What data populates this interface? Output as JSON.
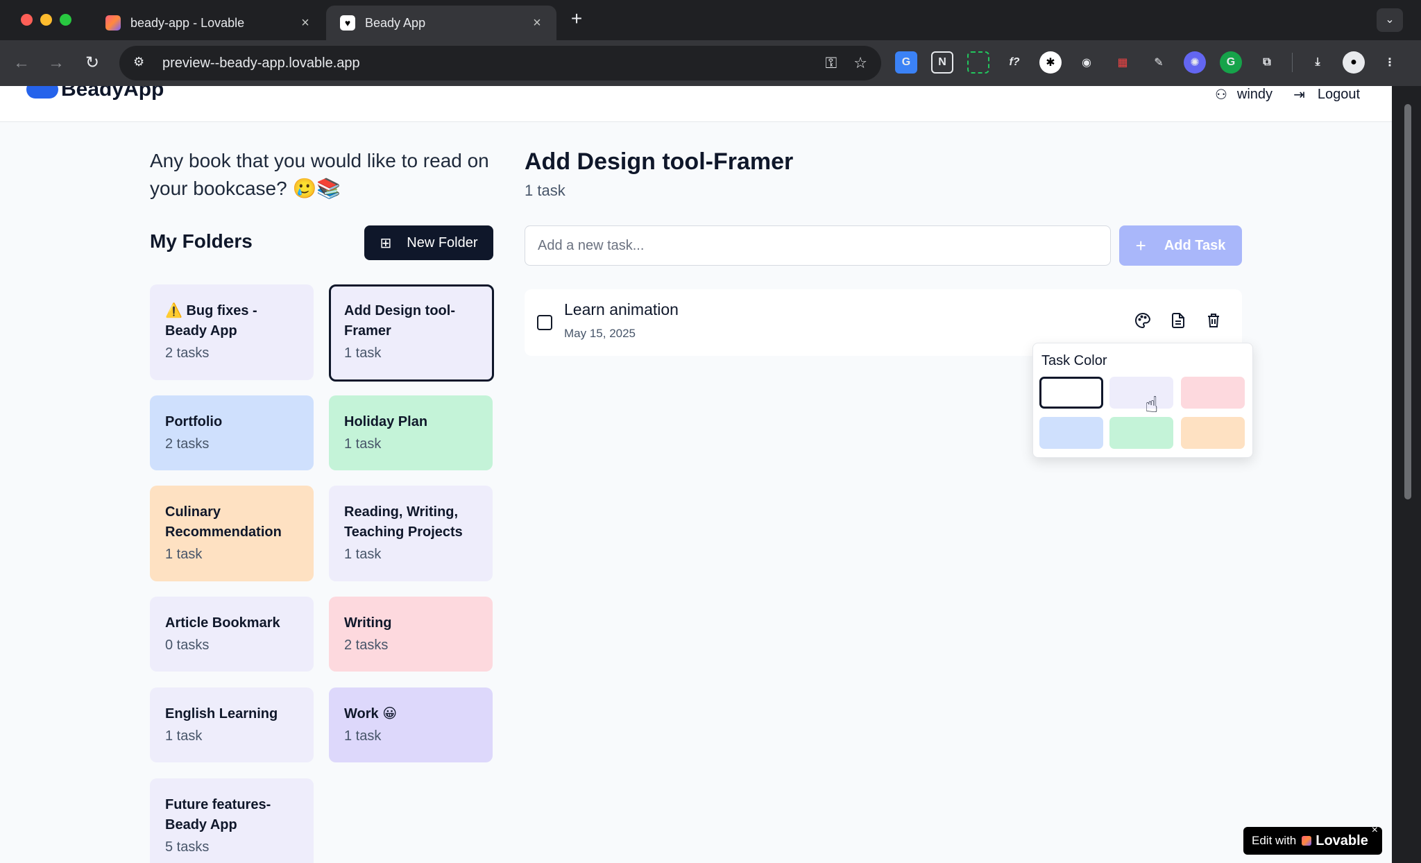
{
  "browser": {
    "tabs": [
      {
        "title": "beady-app - Lovable",
        "active": false
      },
      {
        "title": "Beady App",
        "active": true
      }
    ],
    "url": "preview--beady-app.lovable.app"
  },
  "header": {
    "logo": "BeadyApp",
    "username": "windy",
    "logout_label": "Logout"
  },
  "sidebar": {
    "prompt": "Any book that you would like to read on your bookcase? 🥲📚",
    "folders_title": "My Folders",
    "new_folder_label": "New Folder",
    "folders": [
      {
        "name": "⚠️ Bug fixes - Beady App",
        "count": "2 tasks",
        "color": "#eeedfb"
      },
      {
        "name": "Add Design tool-Framer",
        "count": "1 task",
        "color": "#eeedfb",
        "selected": true
      },
      {
        "name": "Portfolio",
        "count": "2 tasks",
        "color": "#cfe0fd"
      },
      {
        "name": "Holiday Plan",
        "count": "1 task",
        "color": "#c4f3d8"
      },
      {
        "name": "Culinary Recommendation",
        "count": "1 task",
        "color": "#fee1c2"
      },
      {
        "name": "Reading, Writing, Teaching Projects",
        "count": "1 task",
        "color": "#eeedfb"
      },
      {
        "name": "Article Bookmark",
        "count": "0 tasks",
        "color": "#eeedfb"
      },
      {
        "name": "Writing",
        "count": "2 tasks",
        "color": "#fdd9de"
      },
      {
        "name": "English Learning",
        "count": "1 task",
        "color": "#eeedfb"
      },
      {
        "name": "Work 😀",
        "count": "1 task",
        "color": "#ddd8fb"
      },
      {
        "name": "Future features-Beady App",
        "count": "5 tasks",
        "color": "#eeedfb"
      }
    ]
  },
  "main": {
    "title": "Add Design tool-Framer",
    "subtitle": "1 task",
    "input_placeholder": "Add a new task...",
    "add_task_label": "Add Task",
    "tasks": [
      {
        "name": "Learn animation",
        "date": "May 15, 2025",
        "checked": false
      }
    ]
  },
  "color_popup": {
    "title": "Task Color",
    "swatches": [
      "#ffffff",
      "#eeedfb",
      "#fdd9de",
      "#cfe0fd",
      "#c4f3d8",
      "#fee1c2"
    ],
    "selected_index": 0
  },
  "badge": {
    "prefix": "Edit with",
    "name": "Lovable",
    "close": "×"
  },
  "icons": {
    "close": "×",
    "plus": "+",
    "back": "←",
    "forward": "→",
    "reload": "↻"
  }
}
